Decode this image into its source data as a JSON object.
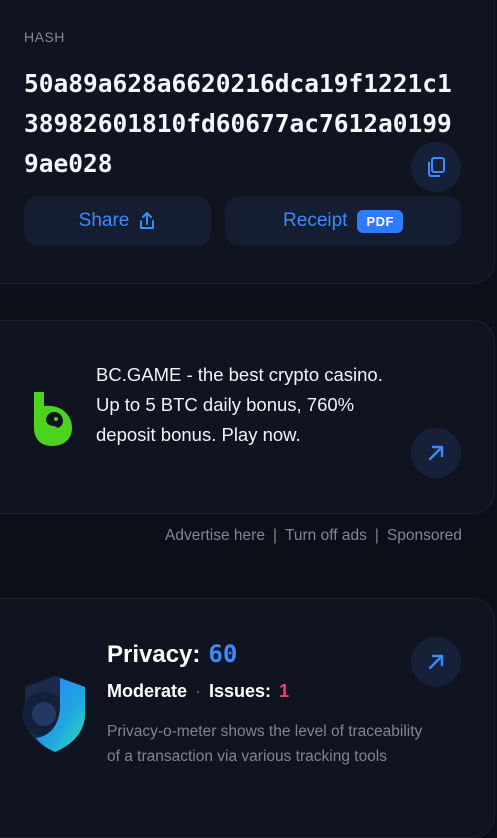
{
  "hash": {
    "label": "HASH",
    "value": "50a89a628a6620216dca19f1221c138982601810fd60677ac7612a01999ae028"
  },
  "actions": {
    "share_label": "Share",
    "receipt_label": "Receipt",
    "pdf_badge": "PDF"
  },
  "ad": {
    "text": "BC.GAME - the best crypto casino. Up to 5 BTC daily bonus, 760% deposit bonus. Play now.",
    "links": [
      "Advertise here",
      "Turn off ads",
      "Sponsored"
    ],
    "separator": "|"
  },
  "privacy": {
    "title": "Privacy:",
    "score": "60",
    "level": "Moderate",
    "separator": "·",
    "issues_label": "Issues:",
    "issues_count": "1",
    "description": "Privacy-o-meter shows the level of traceability of a transaction via various tracking tools"
  },
  "icons": {
    "copy": "copy-icon",
    "share": "share-icon",
    "external": "arrow-up-right-icon",
    "ad_logo": "bc-game-logo",
    "privacy": "shield-icon"
  },
  "colors": {
    "background": "#0b0f18",
    "card": "#0f1420",
    "accent": "#3b8bff",
    "issues": "#ff3b7a",
    "bc_green": "#4cd31e"
  }
}
